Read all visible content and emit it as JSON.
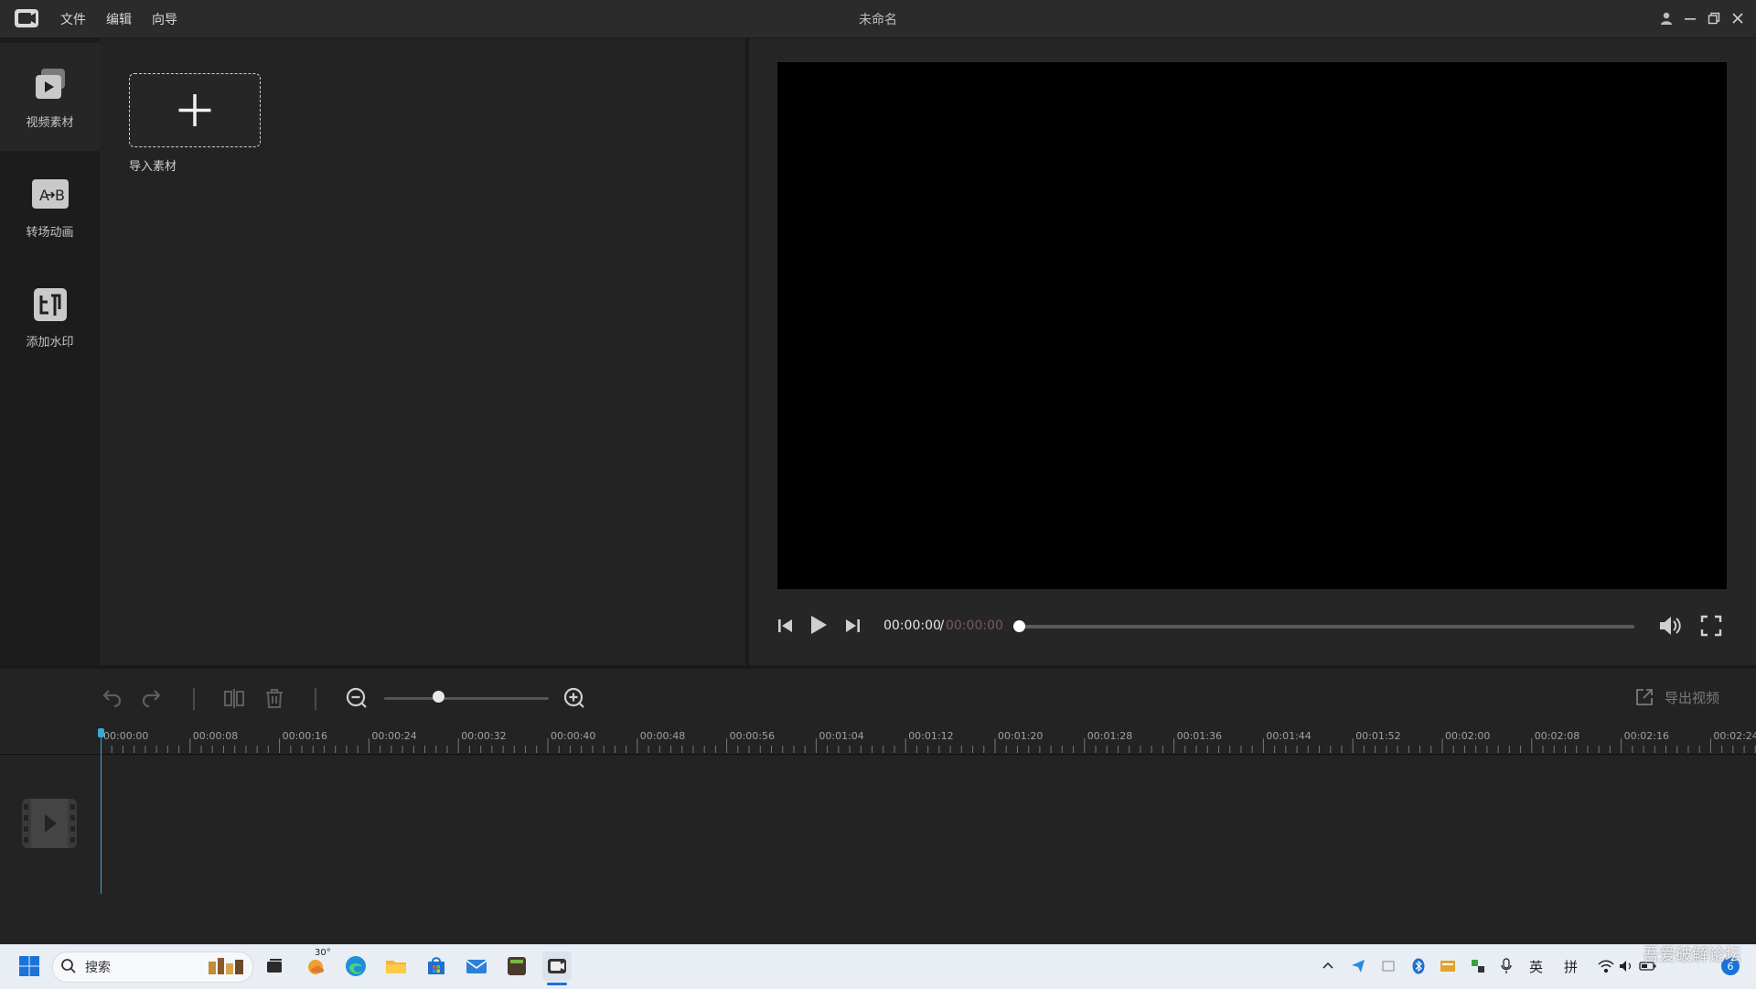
{
  "app": {
    "title": "未命名",
    "menu": [
      "文件",
      "编辑",
      "向导"
    ]
  },
  "sidebar": {
    "items": [
      {
        "label": "视频素材",
        "icon": "video-material-icon",
        "active": true
      },
      {
        "label": "转场动画",
        "icon": "transition-icon",
        "active": false
      },
      {
        "label": "添加水印",
        "icon": "watermark-icon",
        "active": false
      }
    ]
  },
  "media": {
    "import_label": "导入素材"
  },
  "preview": {
    "time_current": "00:00:00",
    "time_separator": " / ",
    "time_total": "00:00:00",
    "progress": 0
  },
  "toolbar": {
    "zoom_level": 0.33,
    "export_label": "导出视频"
  },
  "timeline": {
    "ticks": [
      "00:00:00",
      "00:00:08",
      "00:00:16",
      "00:00:24",
      "00:00:32",
      "00:00:40",
      "00:00:48",
      "00:00:56",
      "00:01:04",
      "00:01:12",
      "00:01:20",
      "00:01:28",
      "00:01:36",
      "00:01:44",
      "00:01:52",
      "00:02:00",
      "00:02:08",
      "00:02:16",
      "00:02:24"
    ]
  },
  "taskbar": {
    "search_placeholder": "搜索",
    "weather_temp": "30°",
    "tray_lang": "英",
    "tray_ime": "拼",
    "notification_count": "6"
  },
  "overlay": {
    "watermark_text": "吾爱破解论坛"
  },
  "colors": {
    "accent": "#39a7d6",
    "background": "#232323",
    "sidebar": "#1c1c1c",
    "taskbar": "#e9eef5"
  }
}
